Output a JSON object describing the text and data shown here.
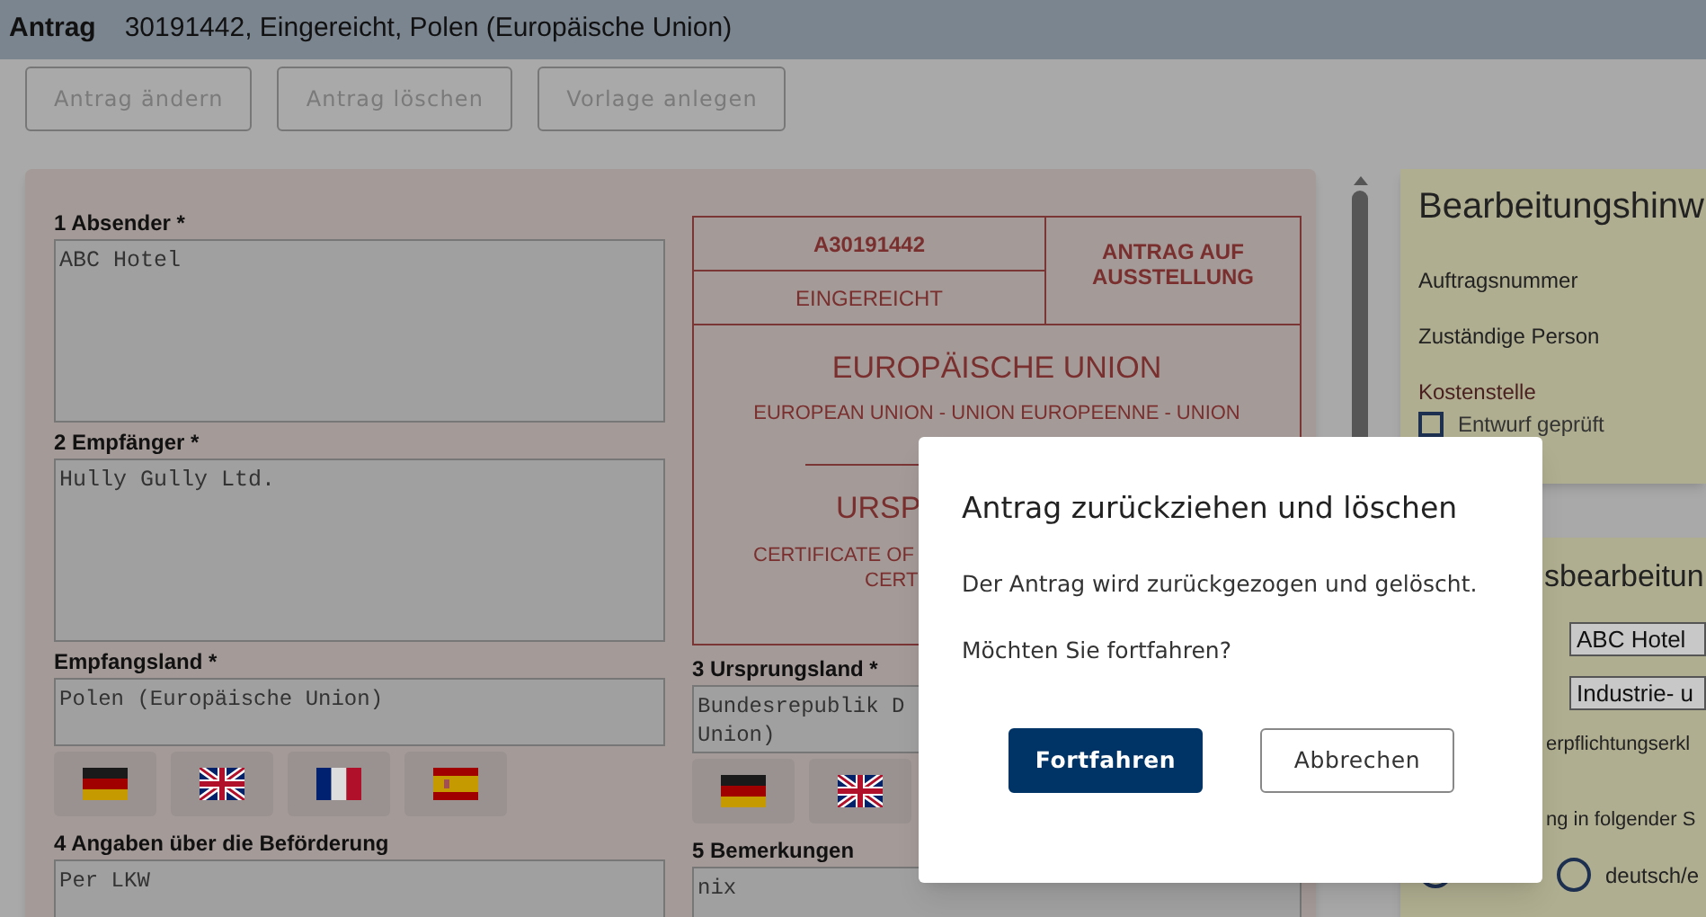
{
  "header": {
    "title": "Antrag",
    "subtitle": "30191442, Eingereicht, Polen (Europäische Union)"
  },
  "actions": [
    "Antrag ändern",
    "Antrag löschen",
    "Vorlage anlegen"
  ],
  "form": {
    "left": [
      {
        "kind": "textarea",
        "label": "1 Absender *",
        "value": "ABC Hotel"
      },
      {
        "kind": "textarea",
        "label": "2 Empfänger *",
        "value": "Hully Gully Ltd."
      },
      {
        "kind": "input",
        "label": "Empfangsland *",
        "lines": [
          "Polen (Europäische Union)"
        ],
        "language_buttons": [
          {
            "kind": "de"
          },
          {
            "kind": "gb"
          },
          {
            "kind": "fr"
          },
          {
            "kind": "es"
          }
        ]
      },
      {
        "kind": "input",
        "label": "4 Angaben über die Beförderung",
        "lines": [
          "Per LKW"
        ]
      }
    ],
    "certificate": {
      "number": "A30191442",
      "status": "EINGEREICHT",
      "type": "ANTRAG AUF AUSSTELLUNG",
      "union": "EUROPÄISCHE UNION",
      "union_languages": "EUROPEAN UNION - UNION EUROPEENNE - UNION",
      "title": "URSP",
      "subtitle_lines": [
        "CERTIFICATE OF",
        "CERT"
      ]
    },
    "right": [
      {
        "kind": "input",
        "label": "3 Ursprungsland *",
        "lines": [
          "Bundesrepublik D",
          "Union)"
        ],
        "language_buttons": [
          {
            "kind": "de"
          },
          {
            "kind": "gb"
          }
        ]
      },
      {
        "kind": "input",
        "label": "5 Bemerkungen",
        "lines": [
          "nix"
        ]
      }
    ]
  },
  "notes_panel": {
    "title": "Bearbeitungshinw",
    "fields": [
      "Auftragsnummer",
      "Zuständige Person",
      "Kostenstelle"
    ],
    "checkbox": {
      "label": "Entwurf geprüft",
      "checked": false
    }
  },
  "panel_2": {
    "title": "sbearbeitun",
    "selects": [
      "ABC Hotel",
      "Industrie- u"
    ],
    "texts": [
      "erpflichtungserkl",
      "ng in folgender S"
    ],
    "radios": [
      {
        "partly_hidden": true
      },
      {
        "label": "deutsch/e",
        "selected": false
      }
    ]
  },
  "dialog": {
    "title": "Antrag zurückziehen und löschen",
    "messages": [
      "Der Antrag wird zurückgezogen und gelöscht.",
      "Möchten Sie fortfahren?"
    ],
    "buttons": [
      {
        "label": "Fortfahren",
        "kind": "primary"
      },
      {
        "label": "Abbrechen",
        "kind": "secondary"
      }
    ]
  }
}
